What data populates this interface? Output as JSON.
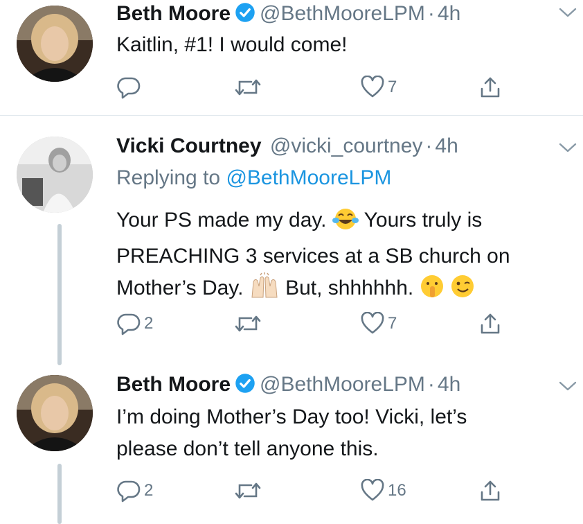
{
  "tweets": [
    {
      "name": "Beth Moore",
      "handle": "@BethMooreLPM",
      "dot": "·",
      "time": "4h",
      "text": "Kaitlin, #1! I would come!",
      "actions": {
        "replies": "",
        "retweets": "",
        "likes": "7"
      }
    },
    {
      "name": "Vicki Courtney",
      "handle": "@vicki_courtney",
      "dot": "·",
      "time": "4h",
      "reply_prefix": "Replying to ",
      "reply_to": "@BethMooreLPM",
      "text_line1a": "Your PS made my day.",
      "text_line1b": "Yours truly is",
      "text_line2": "PREACHING 3 services at a SB church on",
      "text_line3a": "Mother’s Day.",
      "text_line3b": "But, shhhhhh.",
      "actions": {
        "replies": "2",
        "retweets": "",
        "likes": "7"
      }
    },
    {
      "name": "Beth Moore",
      "handle": "@BethMooreLPM",
      "dot": "·",
      "time": "4h",
      "text_line1": "I’m doing Mother’s Day too! Vicki, let’s",
      "text_line2": "please don’t tell anyone this.",
      "actions": {
        "replies": "2",
        "retweets": "",
        "likes": "16"
      }
    }
  ],
  "icons": {
    "verified": "verified-badge-icon",
    "caret": "chevron-down-icon",
    "reply": "reply-icon",
    "retweet": "retweet-icon",
    "like": "heart-icon",
    "share": "share-icon",
    "emoji_laugh": "face-with-tears-of-joy-icon",
    "emoji_hands": "raising-hands-icon",
    "emoji_shush": "shushing-face-icon",
    "emoji_wink": "winking-face-icon"
  },
  "colors": {
    "link": "#1b95e0",
    "secondary": "#657786",
    "verified": "#1da1f2"
  }
}
